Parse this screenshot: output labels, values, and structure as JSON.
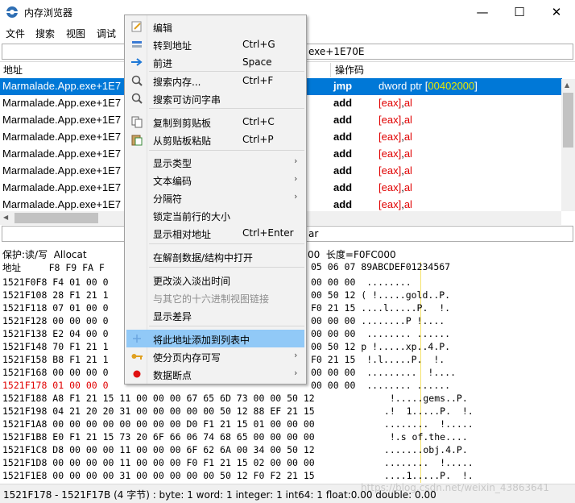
{
  "window": {
    "title": "内存浏览器",
    "controls": {
      "minimize": "—",
      "maximize": "☐",
      "close": "✕"
    }
  },
  "menubar": {
    "file": "文件",
    "search": "搜索",
    "view": "视图",
    "debug": "调试"
  },
  "address_bar": {
    "value": "exe+1E70E"
  },
  "disasm": {
    "headers": {
      "address": "地址",
      "opcode": "操作码"
    },
    "rows": [
      {
        "addr": "Marmalade.App.exe+1E7",
        "op": "jmp",
        "arg_pre": "dword ptr [",
        "arg_num": "00402000",
        "arg_post": "]",
        "selected": true
      },
      {
        "addr": "Marmalade.App.exe+1E7",
        "op": "add",
        "reg1": "[eax]",
        "sep": ",",
        "reg2": "al"
      },
      {
        "addr": "Marmalade.App.exe+1E7",
        "op": "add",
        "reg1": "[eax]",
        "sep": ",",
        "reg2": "al"
      },
      {
        "addr": "Marmalade.App.exe+1E7",
        "op": "add",
        "reg1": "[eax]",
        "sep": ",",
        "reg2": "al"
      },
      {
        "addr": "Marmalade.App.exe+1E7",
        "op": "add",
        "reg1": "[eax]",
        "sep": ",",
        "reg2": "al"
      },
      {
        "addr": "Marmalade.App.exe+1E7",
        "op": "add",
        "reg1": "[eax]",
        "sep": ",",
        "reg2": "al"
      },
      {
        "addr": "Marmalade.App.exe+1E7",
        "op": "add",
        "reg1": "[eax]",
        "sep": ",",
        "reg2": "al"
      },
      {
        "addr": "Marmalade.App.exe+1E7",
        "op": "add",
        "reg1": "[eax]",
        "sep": ",",
        "reg2": "al"
      }
    ]
  },
  "info_bar": {
    "right_text": "ar"
  },
  "hexview": {
    "protection": "保护:读/写  Allocat",
    "size_info": "00  长度=F0FC000",
    "header_left": "地址     F8 F9 FA F",
    "header_right": "05 06 07 89ABCDEF01234567",
    "rows": [
      {
        "left": "1521F0F8 F4 01 00 0",
        "right": "00 00 00  ........"
      },
      {
        "left": "1521F108 28 F1 21 1",
        "right": "00 50 12 ( !.....gold..P."
      },
      {
        "left": "1521F118 07 01 00 0",
        "right": "F0 21 15 ....l.....P.  !."
      },
      {
        "left": "1521F128 00 00 00 0",
        "right": "00 00 00 ........P !...."
      },
      {
        "left": "1521F138 E2 04 00 0",
        "right": "00 00 00  ........ ......"
      },
      {
        "left": "1521F148 70 F1 21 1",
        "right": "00 50 12 p !.....xp..4.P."
      },
      {
        "left": "1521F158 B8 F1 21 1",
        "right": "F0 21 15  !.l.....P.  !."
      },
      {
        "left": "1521F168 00 00 00 0",
        "right": "00 00 00  .........  !...."
      },
      {
        "left": "1521F178 01 00 00 0",
        "right": "00 00 00  ........ ......",
        "red": true
      },
      {
        "left": "1521F188 A8 F1 21 15 11 00 00 00 67 65 6D 73 00 00 50 12",
        "right": "  !.....gems..P."
      },
      {
        "left": "1521F198 04 21 20 20 31 00 00 00 00 00 50 12 88 EF 21 15",
        "right": " .!  1.....P.  !."
      },
      {
        "left": "1521F1A8 00 00 00 00 00 00 00 00 D0 F1 21 15 01 00 00 00",
        "right": " ........  !....."
      },
      {
        "left": "1521F1B8 E0 F1 21 15 73 20 6F 66 06 74 68 65 00 00 00 00",
        "right": "  !.s of.the...."
      },
      {
        "left": "1521F1C8 D8 00 00 00 11 00 00 00 6F 62 6A 00 34 00 50 12",
        "right": " .......obj.4.P."
      },
      {
        "left": "1521F1D8 00 00 00 00 11 00 00 00 F0 F1 21 15 02 00 00 00",
        "right": " ........  !....."
      },
      {
        "left": "1521F1E8 00 00 00 00 31 00 00 00 00 00 50 12 F0 F2 21 15",
        "right": " ....1.....P.  !."
      }
    ]
  },
  "statusbar": {
    "text": "1521F178 - 1521F17B (4 字节) : byte: 1 word: 1 integer: 1 int64: 1 float:0.00 double: 0.00"
  },
  "watermark": "https://blog.csdn.net/weixin_43863641",
  "context_menu": {
    "items": [
      {
        "label": "编辑",
        "icon": "edit-icon"
      },
      {
        "label": "转到地址",
        "shortcut": "Ctrl+G",
        "icon": "goto-icon"
      },
      {
        "label": "前进",
        "shortcut": "Space",
        "icon": "arrow-right-icon"
      },
      {
        "label": "搜索内存...",
        "shortcut": "Ctrl+F",
        "icon": "magnifier-icon"
      },
      {
        "label": "搜索可访问字串",
        "icon": "magnifier-icon"
      },
      {
        "label": "复制到剪贴板",
        "shortcut": "Ctrl+C",
        "icon": "copy-icon"
      },
      {
        "label": "从剪贴板粘贴",
        "shortcut": "Ctrl+P",
        "icon": "paste-icon"
      },
      {
        "label": "显示类型",
        "submenu": "›"
      },
      {
        "label": "文本编码",
        "submenu": "›"
      },
      {
        "label": "分隔符",
        "submenu": "›"
      },
      {
        "label": "锁定当前行的大小"
      },
      {
        "label": "显示相对地址",
        "shortcut": "Ctrl+Enter"
      },
      {
        "label": "在解剖数据/结构中打开"
      },
      {
        "label": "更改淡入淡出时间"
      },
      {
        "label": "与其它的十六进制视图链接"
      },
      {
        "label": "显示差异"
      },
      {
        "label": "将此地址添加到列表中",
        "icon": "plus-icon",
        "highlighted": true
      },
      {
        "label": "使分页内存可写",
        "submenu": "›",
        "icon": "key-icon"
      },
      {
        "label": "数据断点",
        "submenu": "›",
        "icon": "red-dot-icon"
      }
    ]
  },
  "colors": {
    "selection": "#0078d7",
    "menu_highlight": "#91c9f7",
    "register": "#e00000",
    "address_literal": "#e8e800"
  }
}
